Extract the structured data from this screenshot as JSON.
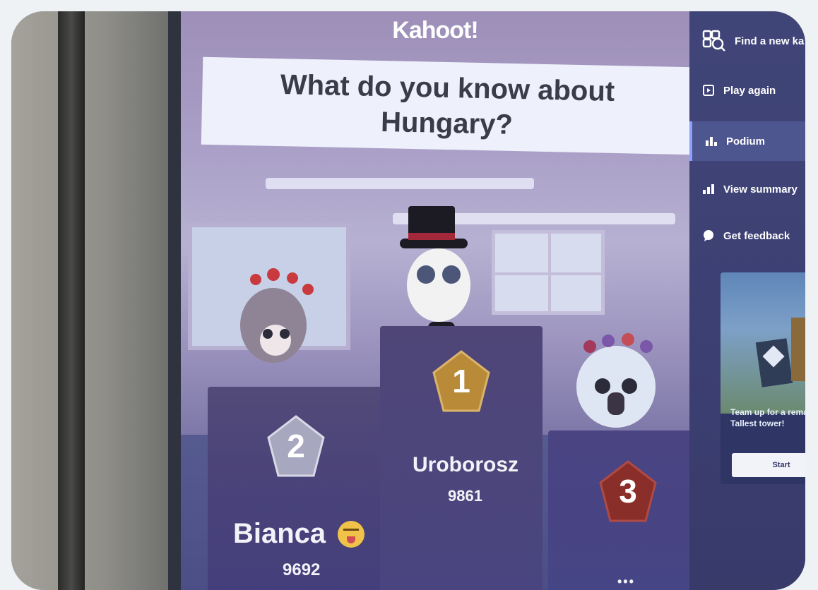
{
  "brand": {
    "logo_text": "Kahoot!"
  },
  "question": {
    "text": "What do you know about Hungary?"
  },
  "podium": {
    "first": {
      "rank": "1",
      "name": "Uroborosz",
      "score": "9861"
    },
    "second": {
      "rank": "2",
      "name": "Bianca",
      "score": "9692",
      "emoji": "laughing-tongue-emoji"
    },
    "third": {
      "rank": "3",
      "name": "",
      "score": "•••"
    }
  },
  "sidebar": {
    "items": [
      {
        "label": "Find a new ka",
        "icon": "search-kahoot-icon"
      },
      {
        "label": "Play again",
        "icon": "play-again-icon"
      },
      {
        "label": "Podium",
        "icon": "podium-icon",
        "active": true
      },
      {
        "label": "View summary",
        "icon": "bar-chart-icon"
      },
      {
        "label": "Get feedback",
        "icon": "speech-bubble-icon"
      }
    ],
    "promo": {
      "text": "Team up for a remat Tallest tower!",
      "button_label": "Start"
    }
  },
  "colors": {
    "gold": "#b98a38",
    "silver": "#a7a7c0",
    "bronze": "#8a2e2a",
    "sidebar_bg": "#3c3f72",
    "active_accent": "#8ca1ff"
  }
}
